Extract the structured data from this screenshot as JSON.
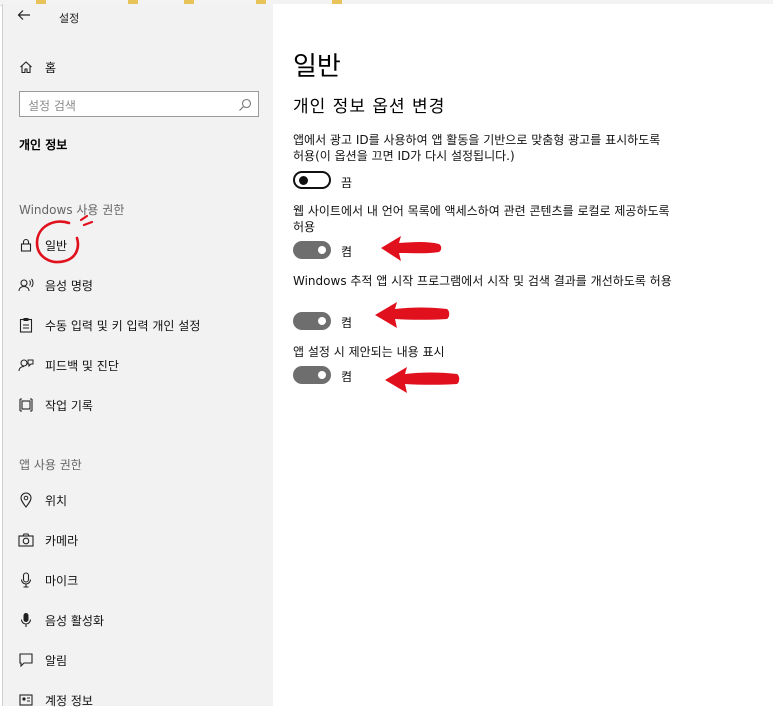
{
  "window": {
    "title": "설정"
  },
  "sidebar": {
    "home_label": "홈",
    "search_placeholder": "설정 검색",
    "section_title": "개인 정보",
    "group_windows": "Windows 사용 권한",
    "windows_items": [
      {
        "label": "일반",
        "icon": "lock-icon",
        "selected": true
      },
      {
        "label": "음성 명령",
        "icon": "speech-icon"
      },
      {
        "label": "수동 입력 및 키 입력 개인 설정",
        "icon": "clipboard-icon"
      },
      {
        "label": "피드백 및 진단",
        "icon": "feedback-icon"
      },
      {
        "label": "작업 기록",
        "icon": "timeline-icon"
      }
    ],
    "group_app": "앱 사용 권한",
    "app_items": [
      {
        "label": "위치",
        "icon": "location-icon"
      },
      {
        "label": "카메라",
        "icon": "camera-icon"
      },
      {
        "label": "마이크",
        "icon": "microphone-icon"
      },
      {
        "label": "음성 활성화",
        "icon": "voice-activation-icon"
      },
      {
        "label": "알림",
        "icon": "notification-icon"
      },
      {
        "label": "계정 정보",
        "icon": "account-info-icon"
      }
    ]
  },
  "main": {
    "title": "일반",
    "subtitle": "개인 정보 옵션 변경",
    "options": [
      {
        "desc": "앱에서 광고 ID를 사용하여 앱 활동을 기반으로 맞춤형 광고를 표시하도록 허용(이 옵션을 끄면 ID가 다시 설정됩니다.)",
        "state": "끔",
        "on": false
      },
      {
        "desc": "웹 사이트에서 내 언어 목록에 액세스하여 관련 콘텐츠를 로컬로 제공하도록 허용",
        "state": "켬",
        "on": true
      },
      {
        "desc": "Windows 추적 앱 시작 프로그램에서 시작 및 검색 결과를 개선하도록 허용",
        "state": "켬",
        "on": true
      },
      {
        "desc": "앱 설정 시 제안되는 내용 표시",
        "state": "켬",
        "on": true
      }
    ]
  },
  "colors": {
    "sidebar_bg": "#f2f2f2",
    "toggle_on": "#6e6e6e",
    "annotation_red": "#e0101c"
  }
}
